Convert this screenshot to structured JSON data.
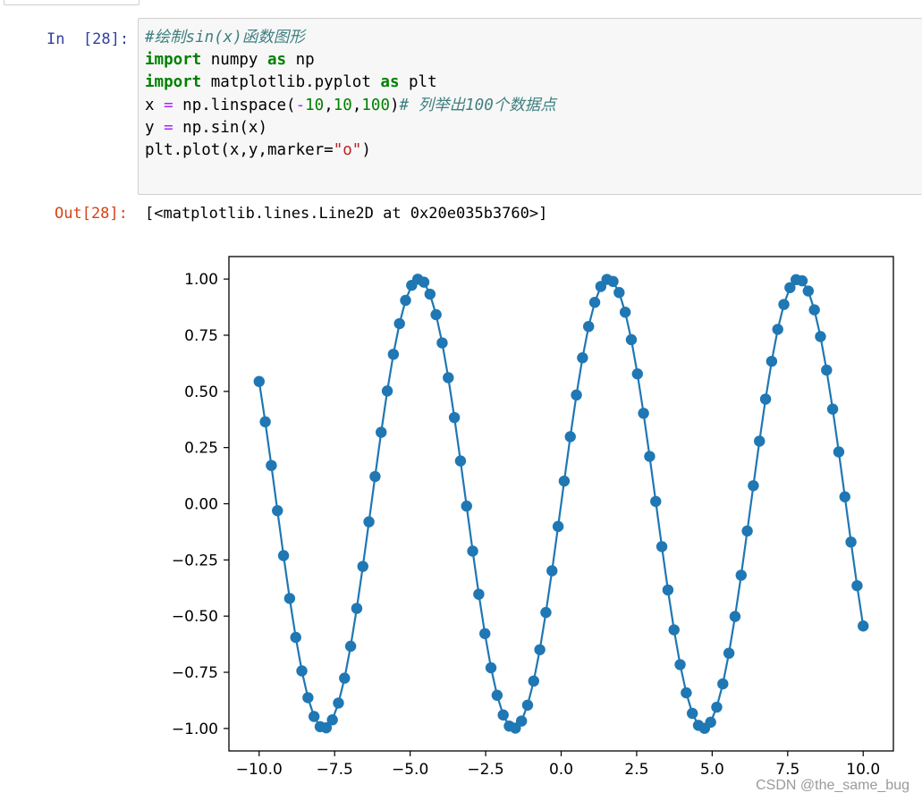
{
  "cell": {
    "in_prompt": "In  [28]:",
    "out_prompt": "Out[28]:",
    "code_lines": [
      [
        {
          "t": "cm",
          "v": "#绘制sin(x)函数图形"
        }
      ],
      [
        {
          "t": "kw",
          "v": "import"
        },
        {
          "t": "",
          "v": " numpy "
        },
        {
          "t": "kw",
          "v": "as"
        },
        {
          "t": "",
          "v": " np"
        }
      ],
      [
        {
          "t": "kw",
          "v": "import"
        },
        {
          "t": "",
          "v": " matplotlib.pyplot "
        },
        {
          "t": "kw",
          "v": "as"
        },
        {
          "t": "",
          "v": " plt"
        }
      ],
      [
        {
          "t": "",
          "v": "x "
        },
        {
          "t": "op",
          "v": "="
        },
        {
          "t": "",
          "v": " np.linspace("
        },
        {
          "t": "op",
          "v": "-"
        },
        {
          "t": "num",
          "v": "10"
        },
        {
          "t": "",
          "v": ","
        },
        {
          "t": "num",
          "v": "10"
        },
        {
          "t": "",
          "v": ","
        },
        {
          "t": "num",
          "v": "100"
        },
        {
          "t": "",
          "v": ")"
        },
        {
          "t": "cm",
          "v": "# 列举出100个数据点"
        }
      ],
      [
        {
          "t": "",
          "v": "y "
        },
        {
          "t": "op",
          "v": "="
        },
        {
          "t": "",
          "v": " np.sin(x)"
        }
      ],
      [
        {
          "t": "",
          "v": "plt.plot(x,y,marker="
        },
        {
          "t": "str",
          "v": "\"o\""
        },
        {
          "t": "",
          "v": ")"
        }
      ]
    ],
    "output_text": "[<matplotlib.lines.Line2D at 0x20e035b3760>]"
  },
  "chart_data": {
    "type": "line",
    "function": "sin",
    "x_start": -10,
    "x_end": 10,
    "n_points": 100,
    "marker": "o",
    "series_color": "#1f77b4",
    "xlim": [
      -11,
      11
    ],
    "ylim": [
      -1.1,
      1.1
    ],
    "x_ticks": [
      -10,
      -7.5,
      -5,
      -2.5,
      0,
      2.5,
      5,
      7.5,
      10
    ],
    "x_tick_labels": [
      "−10.0",
      "−7.5",
      "−5.0",
      "−2.5",
      "0.0",
      "2.5",
      "5.0",
      "7.5",
      "10.0"
    ],
    "y_ticks": [
      1,
      0.75,
      0.5,
      0.25,
      0,
      -0.25,
      -0.5,
      -0.75,
      -1
    ],
    "y_tick_labels": [
      "1.00",
      "0.75",
      "0.50",
      "0.25",
      "0.00",
      "−0.25",
      "−0.50",
      "−0.75",
      "−1.00"
    ],
    "grid": false,
    "title": "",
    "xlabel": "",
    "ylabel": ""
  },
  "watermark": "CSDN @the_same_bug"
}
